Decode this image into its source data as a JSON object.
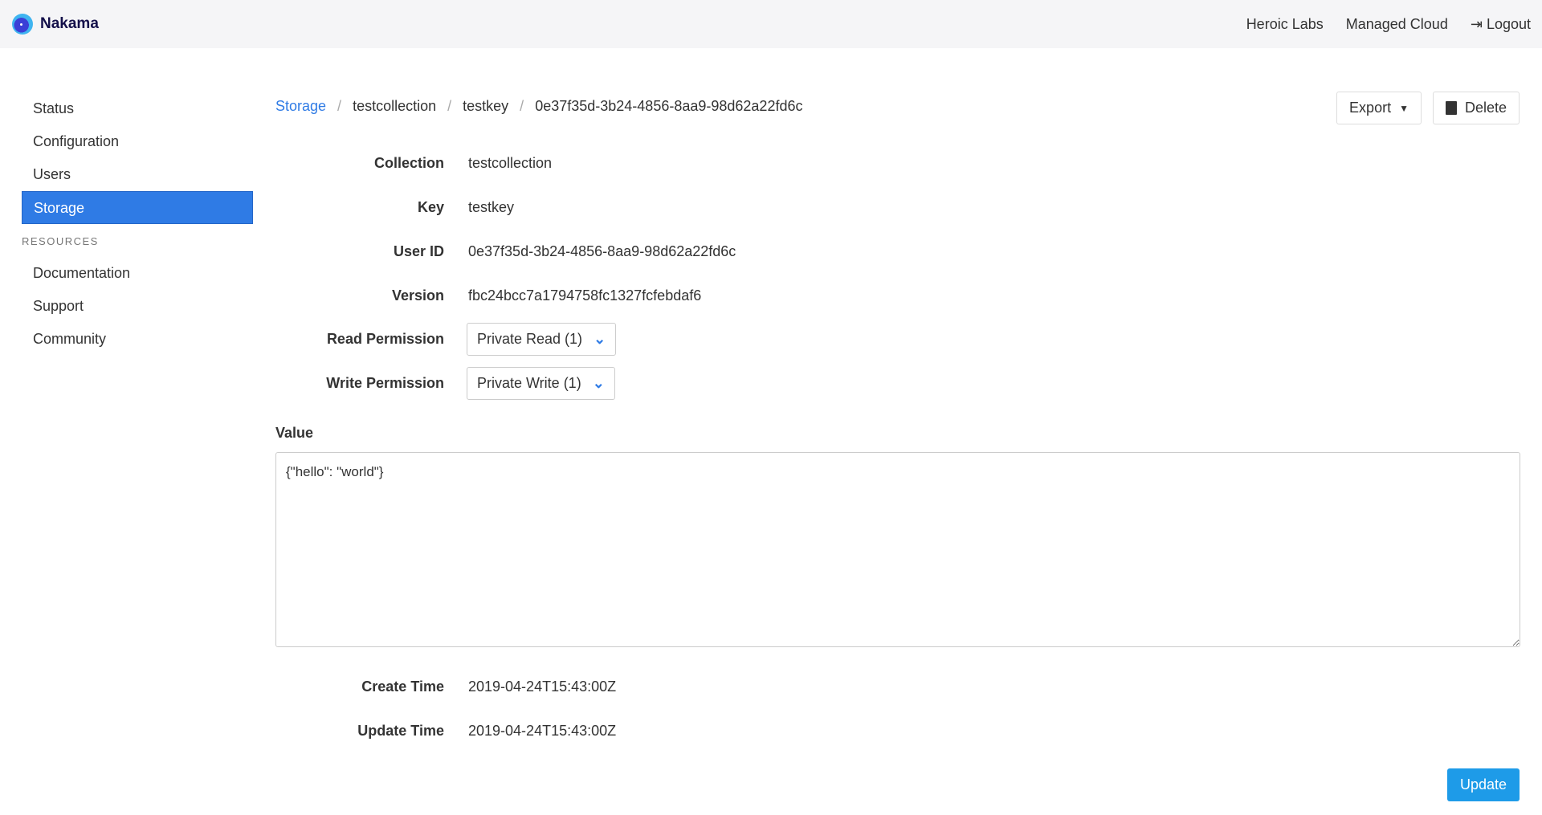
{
  "header": {
    "brand": "Nakama",
    "nav": [
      "Heroic Labs",
      "Managed Cloud",
      "Logout"
    ]
  },
  "sidebar": {
    "items": [
      "Status",
      "Configuration",
      "Users",
      "Storage"
    ],
    "active": "Storage",
    "resources_heading": "RESOURCES",
    "resources": [
      "Documentation",
      "Support",
      "Community"
    ]
  },
  "breadcrumb": [
    "Storage",
    "testcollection",
    "testkey",
    "0e37f35d-3b24-4856-8aa9-98d62a22fd6c"
  ],
  "actions": {
    "export": "Export",
    "delete": "Delete"
  },
  "fields": {
    "collection": {
      "label": "Collection",
      "value": "testcollection"
    },
    "key": {
      "label": "Key",
      "value": "testkey"
    },
    "user_id": {
      "label": "User ID",
      "value": "0e37f35d-3b24-4856-8aa9-98d62a22fd6c"
    },
    "version": {
      "label": "Version",
      "value": "fbc24bcc7a1794758fc1327fcfebdaf6"
    },
    "read": {
      "label": "Read Permission",
      "value": "Private Read (1)"
    },
    "write": {
      "label": "Write Permission",
      "value": "Private Write (1)"
    },
    "value": {
      "label": "Value",
      "value": "{\"hello\": \"world\"}"
    },
    "create": {
      "label": "Create Time",
      "value": "2019-04-24T15:43:00Z"
    },
    "update": {
      "label": "Update Time",
      "value": "2019-04-24T15:43:00Z"
    }
  },
  "update_button": "Update",
  "colors": {
    "accent": "#2f7be5",
    "update": "#1e9be8"
  }
}
